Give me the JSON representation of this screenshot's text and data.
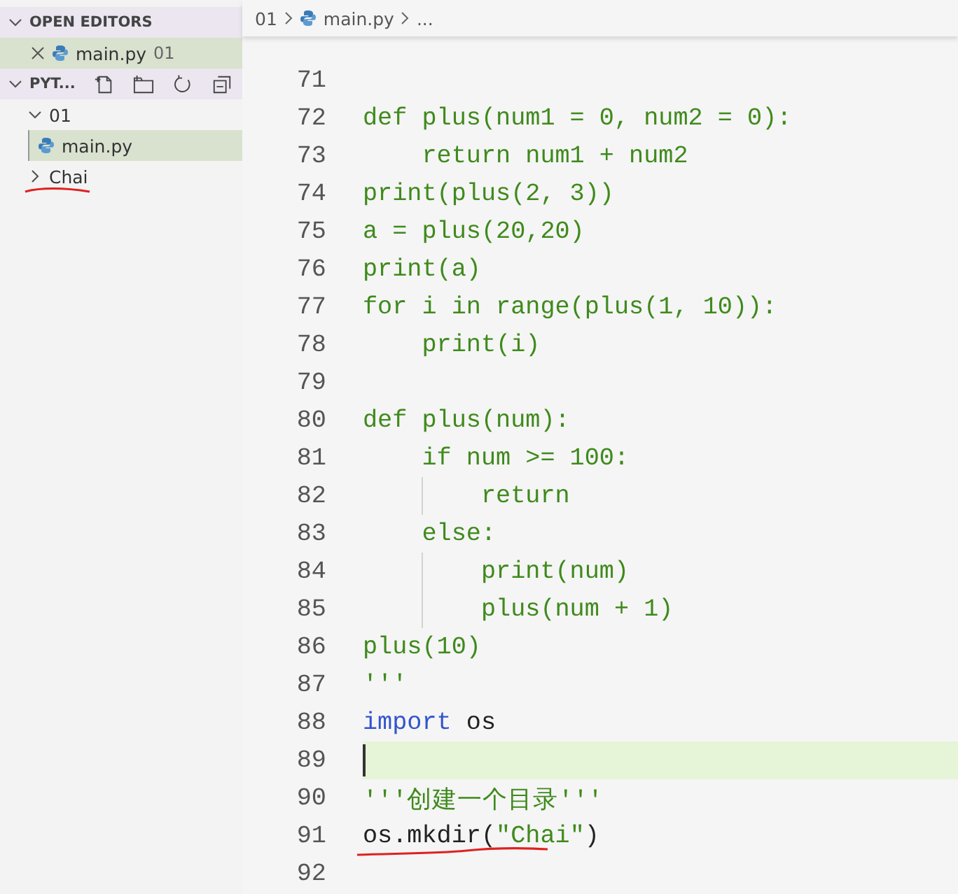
{
  "sidebar": {
    "open_editors": {
      "title": "OPEN EDITORS",
      "expanded": true,
      "files": [
        {
          "name": "main.py",
          "folder": "01",
          "selected": true
        }
      ]
    },
    "project": {
      "title": "PYT...",
      "expanded": true,
      "items": [
        {
          "kind": "folder",
          "name": "01",
          "expanded": true,
          "selected": false,
          "children": [
            {
              "name": "main.py",
              "selected": true
            }
          ]
        },
        {
          "kind": "folder",
          "name": "Chai",
          "expanded": false,
          "selected": false,
          "underlined": true
        }
      ]
    }
  },
  "breadcrumb": [
    "01",
    "main.py",
    "..."
  ],
  "editor": {
    "lines": [
      {
        "number": "71"
      },
      {
        "number": "72",
        "segments": [
          {
            "kind": "string",
            "text": "def plus(num1 = 0, num2 = 0):"
          }
        ]
      },
      {
        "number": "73",
        "segments": [
          {
            "kind": "string",
            "text": "    return num1 + num2"
          }
        ]
      },
      {
        "number": "74",
        "segments": [
          {
            "kind": "string",
            "text": "print(plus(2, 3))"
          }
        ]
      },
      {
        "number": "75",
        "segments": [
          {
            "kind": "string",
            "text": "a = plus(20,20)"
          }
        ]
      },
      {
        "number": "76",
        "segments": [
          {
            "kind": "string",
            "text": "print(a)"
          }
        ]
      },
      {
        "number": "77",
        "segments": [
          {
            "kind": "string",
            "text": "for i in range(plus(1, 10)):"
          }
        ]
      },
      {
        "number": "78",
        "segments": [
          {
            "kind": "string",
            "text": "    print(i)"
          }
        ]
      },
      {
        "number": "79"
      },
      {
        "number": "80",
        "segments": [
          {
            "kind": "string",
            "text": "def plus(num):"
          }
        ]
      },
      {
        "number": "81",
        "segments": [
          {
            "kind": "string",
            "text": "    if num >= 100:"
          }
        ]
      },
      {
        "number": "82",
        "segments": [
          {
            "kind": "string",
            "text": "        return"
          }
        ]
      },
      {
        "number": "83",
        "segments": [
          {
            "kind": "string",
            "text": "    else:"
          }
        ]
      },
      {
        "number": "84",
        "segments": [
          {
            "kind": "string",
            "text": "        print(num)"
          }
        ]
      },
      {
        "number": "85",
        "segments": [
          {
            "kind": "string",
            "text": "        plus(num + 1)"
          }
        ]
      },
      {
        "number": "86",
        "segments": [
          {
            "kind": "string",
            "text": "plus(10)"
          }
        ]
      },
      {
        "number": "87",
        "segments": [
          {
            "kind": "string",
            "text": "'''"
          }
        ]
      },
      {
        "number": "88",
        "segments": [
          {
            "kind": "keyword",
            "text": "import"
          },
          {
            "kind": "plain",
            "text": " os"
          }
        ]
      },
      {
        "number": "89",
        "current": true
      },
      {
        "number": "90",
        "segments": [
          {
            "kind": "string",
            "text": "'''创建一个目录'''"
          }
        ]
      },
      {
        "number": "91",
        "marked": true,
        "segments": [
          {
            "kind": "plain",
            "text": "os.mkdir("
          },
          {
            "kind": "string",
            "text": "\"Chai\""
          },
          {
            "kind": "plain",
            "text": ")"
          }
        ]
      },
      {
        "number": "92"
      }
    ]
  }
}
